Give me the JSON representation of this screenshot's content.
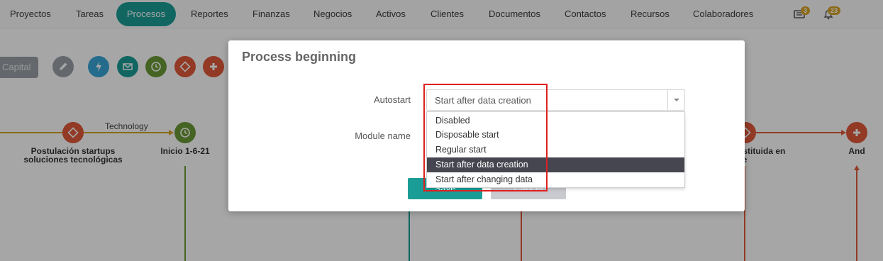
{
  "nav": {
    "items": [
      "Proyectos",
      "Tareas",
      "Procesos",
      "Reportes",
      "Finanzas",
      "Negocios",
      "Activos",
      "Clientes",
      "Documentos",
      "Contactos",
      "Recursos",
      "Colaboradores"
    ],
    "active": "Procesos",
    "news_badge": "3",
    "notifications_badge": "23"
  },
  "toolbar": {
    "capital_label": "Capital",
    "icons": [
      "pencil-icon",
      "lightning-icon",
      "mail-icon",
      "clock-icon",
      "diamond-icon",
      "plus-icon"
    ]
  },
  "diagram": {
    "edge_label": "Technology",
    "nodes": [
      {
        "label_line1": "Postulación startups",
        "label_line2": "soluciones tecnológicas"
      },
      {
        "label_line1": "Inicio 1-6-21",
        "label_line2": ""
      },
      {
        "label_line1": "nstituida en",
        "label_line2": "ile"
      },
      {
        "label_line1": "And",
        "label_line2": ""
      }
    ]
  },
  "modal": {
    "title": "Process beginning",
    "autostart_label": "Autostart",
    "module_name_label": "Module name",
    "autostart_value": "Start after data creation",
    "options": [
      "Disabled",
      "Disposable start",
      "Regular start",
      "Start after data creation",
      "Start after changing data"
    ],
    "selected_option": "Start after data creation",
    "save_label": "Save",
    "cancel_label": "Cancel"
  },
  "colors": {
    "teal": "#1b9d97",
    "orange_red": "#e05a3a",
    "green": "#6a9a36",
    "blue": "#3aa7d8",
    "highlight": "#e02020"
  }
}
